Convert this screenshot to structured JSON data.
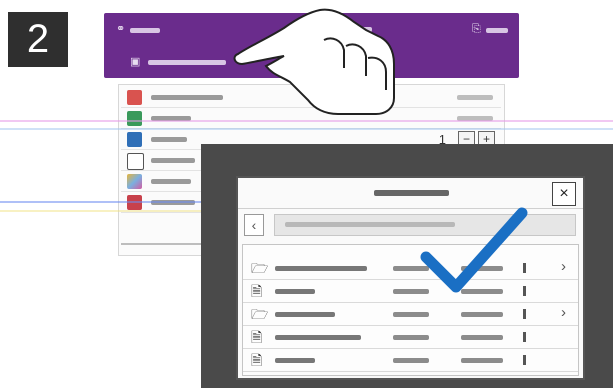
{
  "step": {
    "number": "2"
  },
  "colors": {
    "header_purple": "#6a2c8c",
    "device_dark": "#4a4a4a",
    "checkmark_blue": "#1a6fc4"
  },
  "header": {
    "user_icon": "user-icon",
    "menu_icon": "device-menu-icon",
    "subitem_icon": "folder-icon"
  },
  "app_list": {
    "rows": [
      {
        "icon": "red-app-icon"
      },
      {
        "icon": "green-app-icon"
      },
      {
        "icon": "blue-app-icon"
      },
      {
        "icon": "scan-app-icon"
      },
      {
        "icon": "multicolor-app-icon"
      },
      {
        "icon": "red-printer-icon"
      }
    ],
    "quantity": "1",
    "minus": "−",
    "plus": "+"
  },
  "dialog": {
    "close": "×",
    "back": "‹",
    "files": [
      {
        "icon": "folder-icon",
        "chevron": "›"
      },
      {
        "icon": "document-icon",
        "chevron": ""
      },
      {
        "icon": "folder-icon",
        "chevron": "›"
      },
      {
        "icon": "document-icon",
        "chevron": ""
      },
      {
        "icon": "document-icon",
        "chevron": ""
      }
    ]
  }
}
